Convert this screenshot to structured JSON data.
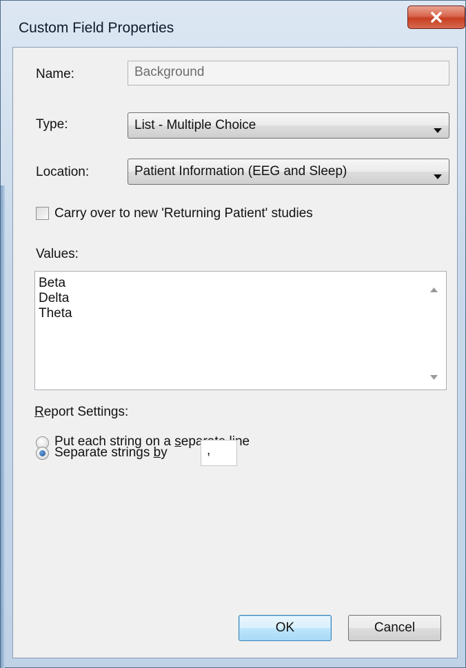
{
  "window": {
    "title": "Custom Field Properties"
  },
  "name_field": {
    "label": "Name:",
    "value": "Background"
  },
  "type_field": {
    "label": "Type:",
    "value": "List - Multiple Choice"
  },
  "location_field": {
    "label": "Location:",
    "value": "Patient Information (EEG and Sleep)"
  },
  "carry_over": {
    "label": "Carry over to new 'Returning Patient' studies",
    "checked": false
  },
  "values": {
    "label": "Values:",
    "items": [
      "Beta",
      "Delta",
      "Theta"
    ]
  },
  "report_settings": {
    "label_prefix": "R",
    "label_rest": "eport Settings:",
    "option_separate_line": {
      "label_before": "Put each string on a ",
      "label_mnemonic": "s",
      "label_after": "eparate line",
      "checked": false
    },
    "option_separate_by": {
      "label_before": "Separate strings ",
      "label_mnemonic": "b",
      "label_after": "y",
      "checked": true,
      "separator": ","
    }
  },
  "buttons": {
    "ok": "OK",
    "cancel": "Cancel"
  },
  "icons": {
    "close": "close-icon",
    "dropdown": "chevron-down-icon"
  },
  "colors": {
    "close_button": "#c73f22",
    "title_bar": "#c9d9ea",
    "client": "#f0f0f0",
    "default_button": "#bee6fd"
  }
}
